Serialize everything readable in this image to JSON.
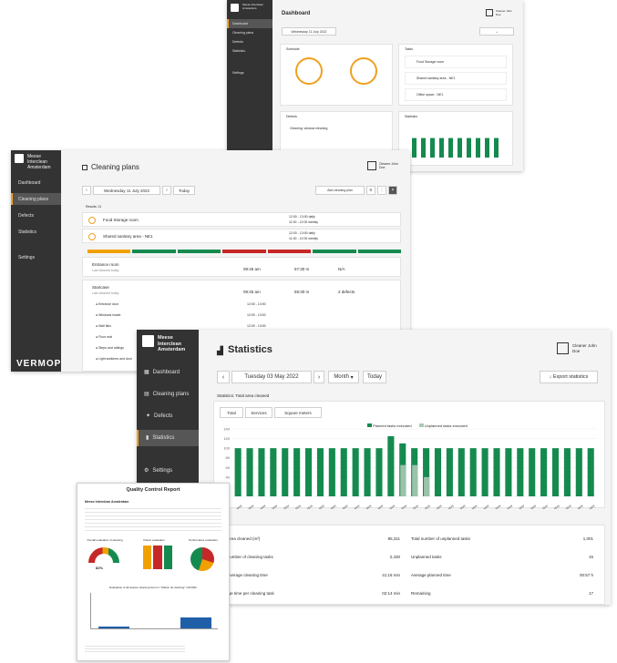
{
  "dashboard": {
    "brand": "Meese Interclean Amsterdam",
    "title": "Dashboard",
    "date": "Wednesday 11 July 2022",
    "nav": [
      "Dashboard",
      "Cleaning plans",
      "Defects",
      "Statistics",
      "Settings"
    ],
    "widgets": {
      "schedule_title": "Schedule",
      "tasks_title": "Tasks",
      "defects_title": "Defects",
      "statistics_title": "Statistics",
      "task_items": [
        "Food Storage room",
        "Shared sanitary area - NE1",
        "Office space - NE1"
      ],
      "defect_entry": "Cleaning: window cleaning"
    },
    "user": "Cleaner John Doe"
  },
  "cleaning": {
    "brand": "Meese Interclean Amsterdam",
    "title": "Cleaning plans",
    "date": "Wednesday 11 July 2022",
    "today_label": "Today",
    "toolbar_label": "Add cleaning plan",
    "nav": [
      "Dashboard",
      "Cleaning plans",
      "Defects",
      "Statistics",
      "Settings"
    ],
    "user": "Cleaner John Doe",
    "list_header": "Results: 11",
    "plans": [
      {
        "name": "Food Storage room",
        "time_a": "12:00 - 13:00 daily",
        "time_b": "11:00 - 12:00 weekly"
      },
      {
        "name": "Shared sanitary area - NE1",
        "time_a": "12:00 - 13:00 daily",
        "time_b": "11:00 - 12:00 weekly"
      }
    ],
    "status_colors": [
      "#f2a000",
      "#158a4f",
      "#158a4f",
      "#c62828",
      "#c62828",
      "#158a4f",
      "#158a4f"
    ],
    "details": [
      {
        "title": "Entrance room",
        "sub": "Last cleaned today",
        "v1": "09:45 am",
        "v2": "57:30 m",
        "v3": "N/A"
      },
      {
        "title": "Staircase",
        "sub": "Last cleaned today",
        "v1": "09:45 am",
        "v2": "59:30 m",
        "v3": "2 defects"
      }
    ],
    "sub_items": [
      {
        "label": "Entrance door",
        "value": "12:00 - 13:00"
      },
      {
        "label": "Windows inside",
        "value": "12:00 - 13:00"
      },
      {
        "label": "Wall tiles",
        "value": "12:00 - 13:00"
      },
      {
        "label": "Floor mat",
        "value": "12:00 - 13:00"
      },
      {
        "label": "Steps and railings",
        "value": "12:00 - 13:00"
      },
      {
        "label": "Light switches and door",
        "value": "12:00 - 13:00"
      }
    ],
    "footer_logo": "VERMOP"
  },
  "statistics": {
    "brand": "Meese Interclean Amsterdam",
    "title": "Statistics",
    "date": "Tuesday 03 May 2022",
    "period": "Month",
    "today_label": "Today",
    "export_label": "Export statistics",
    "nav": [
      "Dashboard",
      "Cleaning plans",
      "Defects",
      "Statistics",
      "Settings"
    ],
    "user": "Cleaner John Doe",
    "subtitle": "Statistics: Total area cleaned",
    "filters": [
      "Total",
      "Services",
      "Square meters"
    ],
    "legend": [
      "Planned tasks executed",
      "Unplanned tasks executed"
    ],
    "series_colors": [
      "#158a4f",
      "#a9c9b4"
    ],
    "stats_left": [
      {
        "label": "Total area cleaned (m²)",
        "value": "85,311"
      },
      {
        "label": "Total number of cleaning tasks",
        "value": "2,430"
      },
      {
        "label": "Total average cleaning time",
        "value": "41:18 min"
      },
      {
        "label": "Average time per cleaning task",
        "value": "02:14 min"
      }
    ],
    "stats_right": [
      {
        "label": "Total number of unplanned tasks",
        "value": "1,001"
      },
      {
        "label": "Unplanned tasks",
        "value": "15"
      },
      {
        "label": "Average planned time",
        "value": "00:57 h"
      },
      {
        "label": "Remaining",
        "value": "17"
      }
    ]
  },
  "chart_data": {
    "type": "bar",
    "categories": [
      "01 May",
      "02 May",
      "03 May",
      "04 May",
      "05 May",
      "06 May",
      "07 May",
      "08 May",
      "09 May",
      "10 May",
      "11 May",
      "12 May",
      "13 May",
      "14 May",
      "15 May",
      "16 May",
      "17 May",
      "18 May",
      "19 May",
      "20 May",
      "21 May",
      "22 May",
      "23 May",
      "24 May",
      "25 May",
      "26 May",
      "27 May",
      "28 May",
      "29 May",
      "30 May",
      "31 May"
    ],
    "series": [
      {
        "name": "Planned tasks executed",
        "values": [
          100,
          100,
          100,
          100,
          100,
          100,
          100,
          100,
          100,
          100,
          100,
          100,
          100,
          125,
          110,
          100,
          100,
          100,
          100,
          100,
          100,
          100,
          100,
          100,
          100,
          100,
          100,
          100,
          100,
          100,
          100
        ]
      },
      {
        "name": "Unplanned tasks executed",
        "values": [
          0,
          0,
          0,
          0,
          0,
          0,
          0,
          0,
          0,
          0,
          0,
          0,
          0,
          0,
          65,
          65,
          40,
          0,
          0,
          0,
          0,
          0,
          0,
          0,
          0,
          0,
          0,
          0,
          0,
          0,
          0
        ]
      }
    ],
    "ylim": [
      0,
      140
    ]
  },
  "report": {
    "title": "Quality Control Report",
    "company": "Meese Interclean Amsterdam",
    "sections": [
      "Overall evaluation of cleaning",
      "Defect evaluation",
      "Performance evaluation"
    ],
    "score": "82%",
    "bottom_title": "Evaluation of all spaces cleaning items in \"Station de cleaning\" 1/2/2022"
  }
}
